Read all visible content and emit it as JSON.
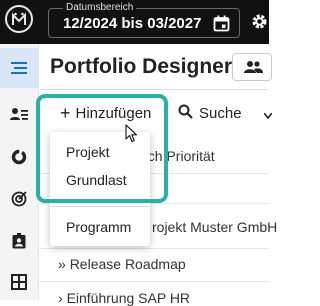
{
  "date_range": {
    "label": "Datumsbereich",
    "value": "12/2024 bis 03/2027"
  },
  "page": {
    "title": "Portfolio Designer"
  },
  "toolbar": {
    "add_label": "Hinzufügen",
    "search_label": "Suche"
  },
  "add_menu": {
    "items": [
      {
        "label": "Projekt"
      },
      {
        "label": "Grundlast"
      },
      {
        "label": "Programm"
      }
    ]
  },
  "background": {
    "group_text": "ach Priorität",
    "rows": [
      {
        "text": "rojekt Muster GmbH"
      },
      {
        "text": "Release Roadmap"
      },
      {
        "text": "Einführung SAP HR"
      }
    ]
  },
  "sidebar": {
    "icons": [
      "menu-icon",
      "person-list-icon",
      "donut-chart-icon",
      "target-icon",
      "badge-icon",
      "grid-icon"
    ]
  },
  "colors": {
    "accent": "#26b3a7",
    "topbar": "#111111",
    "sidebar_active": "#d8e6f7"
  }
}
